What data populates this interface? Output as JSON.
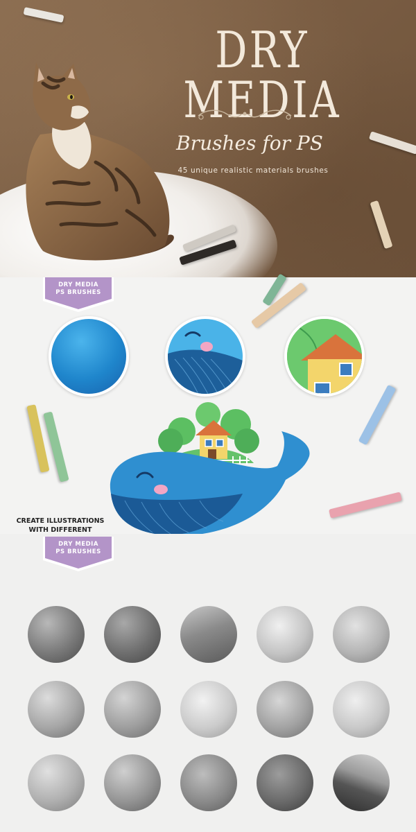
{
  "hero": {
    "title": "DRY MEDIA",
    "subtitle": "Brushes for PS",
    "tagline": "45 unique realistic materials brushes",
    "colors": {
      "background": "#7a5d43",
      "title": "#f3e9db"
    }
  },
  "section_effects": {
    "ribbon_line1": "DRY MEDIA",
    "ribbon_line2": "PS BRUSHES",
    "caption_line1": "CREATE ILLUSTRATIONS",
    "caption_line2": "WITH DIFFERENT EFFECTS",
    "samples": [
      "blue-texture-swatch",
      "whale-detail-swatch",
      "house-detail-swatch"
    ],
    "colors": {
      "ribbon": "#b394c8",
      "whale": "#2f8fd0"
    }
  },
  "section_textures": {
    "ribbon_line1": "DRY MEDIA",
    "ribbon_line2": "PS BRUSHES",
    "swatch_count": 15
  }
}
